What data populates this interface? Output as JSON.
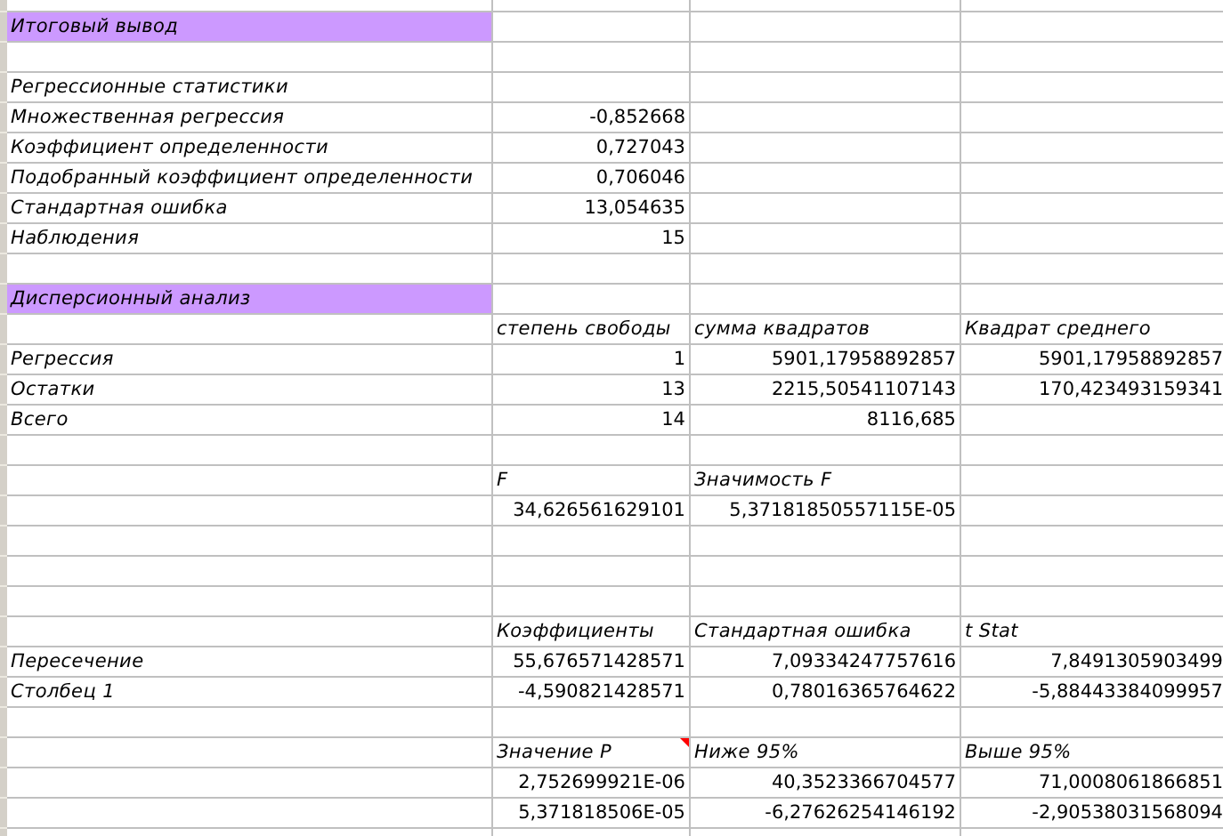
{
  "sheet": {
    "rows": [
      {
        "kind": "partial"
      },
      {
        "kind": "section",
        "column_a": {
          "text": "Итоговый вывод",
          "kind": "label"
        }
      },
      {
        "kind": "data"
      },
      {
        "kind": "data",
        "column_a": {
          "text": "Регрессионные статистики",
          "kind": "label"
        }
      },
      {
        "kind": "data",
        "column_a": {
          "text": "Множественная регрессия",
          "kind": "label"
        },
        "column_b": {
          "text": "-0,852668",
          "kind": "number"
        }
      },
      {
        "kind": "data",
        "column_a": {
          "text": "Коэффициент определенности",
          "kind": "label"
        },
        "column_b": {
          "text": "0,727043",
          "kind": "number"
        }
      },
      {
        "kind": "data",
        "column_a": {
          "text": "Подобранный коэффициент определенности",
          "kind": "label"
        },
        "column_b": {
          "text": "0,706046",
          "kind": "number"
        }
      },
      {
        "kind": "data",
        "column_a": {
          "text": "Стандартная ошибка",
          "kind": "label"
        },
        "column_b": {
          "text": "13,054635",
          "kind": "number"
        }
      },
      {
        "kind": "data",
        "column_a": {
          "text": "Наблюдения",
          "kind": "label"
        },
        "column_b": {
          "text": "15",
          "kind": "number"
        }
      },
      {
        "kind": "data"
      },
      {
        "kind": "section",
        "column_a": {
          "text": "Дисперсионный анализ",
          "kind": "label"
        }
      },
      {
        "kind": "data",
        "column_b": {
          "text": "степень свободы",
          "kind": "label"
        },
        "column_c": {
          "text": "сумма квадратов",
          "kind": "label"
        },
        "column_d": {
          "text": "Квадрат среднего",
          "kind": "label"
        }
      },
      {
        "kind": "data",
        "column_a": {
          "text": "Регрессия",
          "kind": "label"
        },
        "column_b": {
          "text": "1",
          "kind": "number"
        },
        "column_c": {
          "text": "5901,17958892857",
          "kind": "number"
        },
        "column_d": {
          "text": "5901,17958892857",
          "kind": "number"
        }
      },
      {
        "kind": "data",
        "column_a": {
          "text": "Остатки",
          "kind": "label"
        },
        "column_b": {
          "text": "13",
          "kind": "number"
        },
        "column_c": {
          "text": "2215,50541107143",
          "kind": "number"
        },
        "column_d": {
          "text": "170,423493159341",
          "kind": "number"
        }
      },
      {
        "kind": "data",
        "column_a": {
          "text": "Всего",
          "kind": "label"
        },
        "column_b": {
          "text": "14",
          "kind": "number"
        },
        "column_c": {
          "text": "8116,685",
          "kind": "number"
        }
      },
      {
        "kind": "data"
      },
      {
        "kind": "data",
        "column_b": {
          "text": "F",
          "kind": "label"
        },
        "column_c": {
          "text": "Значимость F",
          "kind": "label"
        }
      },
      {
        "kind": "data",
        "column_b": {
          "text": "34,626561629101",
          "kind": "number"
        },
        "column_c": {
          "text": "5,37181850557115E-05",
          "kind": "number"
        }
      },
      {
        "kind": "data"
      },
      {
        "kind": "data"
      },
      {
        "kind": "data"
      },
      {
        "kind": "data",
        "column_b": {
          "text": "Коэффициенты",
          "kind": "label"
        },
        "column_c": {
          "text": "Стандартная ошибка",
          "kind": "label"
        },
        "column_d": {
          "text": "t Stat",
          "kind": "label"
        }
      },
      {
        "kind": "data",
        "column_a": {
          "text": "Пересечение",
          "kind": "label"
        },
        "column_b": {
          "text": "55,676571428571",
          "kind": "number"
        },
        "column_c": {
          "text": "7,09334247757616",
          "kind": "number"
        },
        "column_d": {
          "text": "7,8491305903499",
          "kind": "number"
        }
      },
      {
        "kind": "data",
        "column_a": {
          "text": "Столбец 1",
          "kind": "label"
        },
        "column_b": {
          "text": "-4,590821428571",
          "kind": "number"
        },
        "column_c": {
          "text": "0,78016365764622",
          "kind": "number"
        },
        "column_d": {
          "text": "-5,88443384099957",
          "kind": "number"
        }
      },
      {
        "kind": "data"
      },
      {
        "kind": "data",
        "column_b": {
          "text": "Значение P",
          "kind": "label",
          "comment_marker": true
        },
        "column_c": {
          "text": "Ниже 95%",
          "kind": "label"
        },
        "column_d": {
          "text": "Выше 95%",
          "kind": "label"
        }
      },
      {
        "kind": "data",
        "column_b": {
          "text": "2,752699921E-06",
          "kind": "number"
        },
        "column_c": {
          "text": "40,3523366704577",
          "kind": "number"
        },
        "column_d": {
          "text": "71,0008061866851",
          "kind": "number"
        }
      },
      {
        "kind": "data",
        "column_b": {
          "text": "5,371818506E-05",
          "kind": "number"
        },
        "column_c": {
          "text": "-6,27626254146192",
          "kind": "number"
        },
        "column_d": {
          "text": "-2,90538031568094",
          "kind": "number"
        }
      },
      {
        "kind": "data"
      }
    ]
  }
}
